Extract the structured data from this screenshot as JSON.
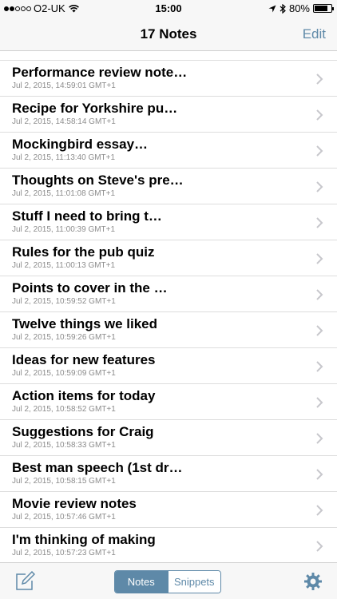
{
  "status_bar": {
    "carrier": "O2-UK",
    "time": "15:00",
    "battery_text": "80%",
    "battery_level": 0.8,
    "signal_bars_filled": 2,
    "signal_bars_total": 5
  },
  "nav": {
    "title": "17 Notes",
    "edit_label": "Edit"
  },
  "notes": [
    {
      "title": "Performance review note…",
      "date": "Jul 2, 2015, 14:59:01 GMT+1"
    },
    {
      "title": "Recipe for Yorkshire pu…",
      "date": "Jul 2, 2015, 14:58:14 GMT+1"
    },
    {
      "title": "Mockingbird essay…",
      "date": "Jul 2, 2015, 11:13:40 GMT+1"
    },
    {
      "title": "Thoughts on Steve's pre…",
      "date": "Jul 2, 2015, 11:01:08 GMT+1"
    },
    {
      "title": "Stuff I need to bring t…",
      "date": "Jul 2, 2015, 11:00:39 GMT+1"
    },
    {
      "title": "Rules for the pub quiz",
      "date": "Jul 2, 2015, 11:00:13 GMT+1"
    },
    {
      "title": "Points to cover in the …",
      "date": "Jul 2, 2015, 10:59:52 GMT+1"
    },
    {
      "title": "Twelve things we liked",
      "date": "Jul 2, 2015, 10:59:26 GMT+1"
    },
    {
      "title": "Ideas for new features",
      "date": "Jul 2, 2015, 10:59:09 GMT+1"
    },
    {
      "title": "Action items for today",
      "date": "Jul 2, 2015, 10:58:52 GMT+1"
    },
    {
      "title": "Suggestions for Craig",
      "date": "Jul 2, 2015, 10:58:33 GMT+1"
    },
    {
      "title": "Best man speech (1st dr…",
      "date": "Jul 2, 2015, 10:58:15 GMT+1"
    },
    {
      "title": "Movie review notes",
      "date": "Jul 2, 2015, 10:57:46 GMT+1"
    },
    {
      "title": "I'm thinking of making",
      "date": "Jul 2, 2015, 10:57:23 GMT+1"
    }
  ],
  "tab_bar": {
    "segments": [
      "Notes",
      "Snippets"
    ],
    "selected": "Notes",
    "compose_icon": "compose-icon",
    "settings_icon": "gear-icon"
  },
  "colors": {
    "accent": "#5e89a8",
    "date_text": "#8c8c8c",
    "separator": "#dddddd",
    "bar_background": "#f7f7f7"
  }
}
